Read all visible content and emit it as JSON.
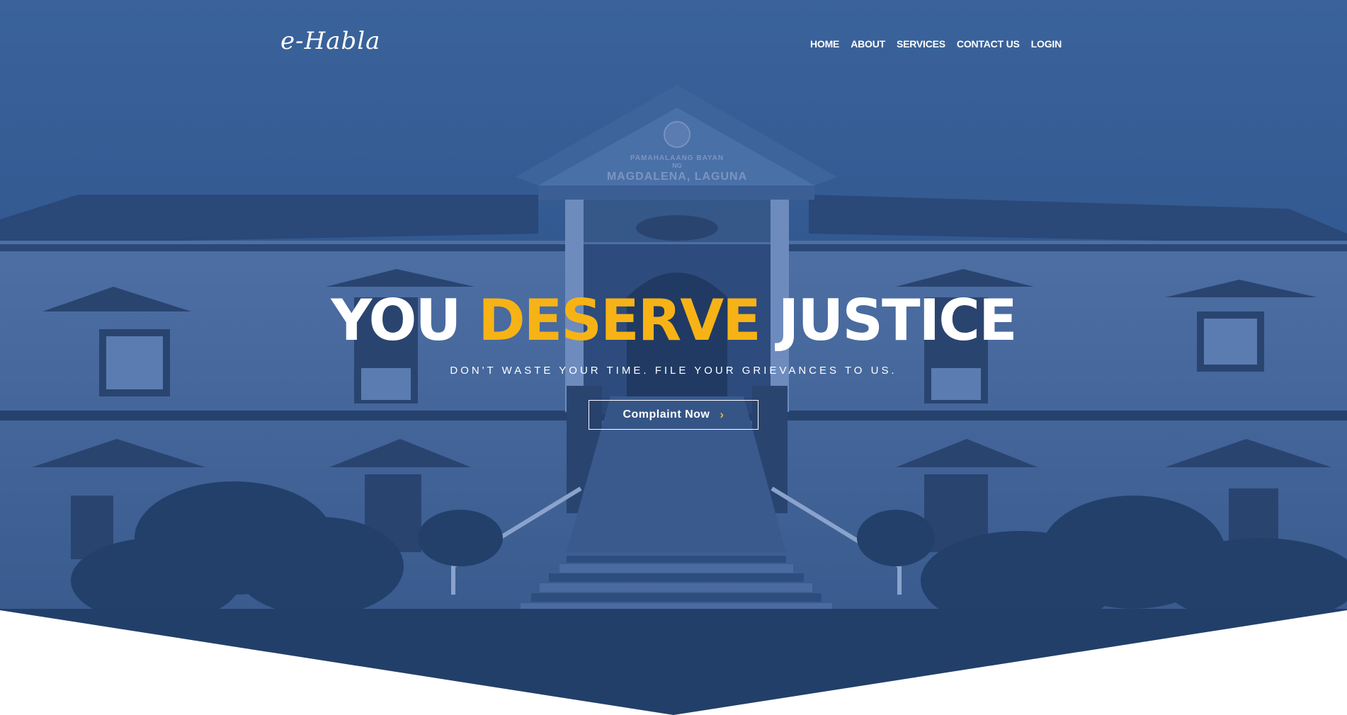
{
  "brand": {
    "logo_text": "e-Habla"
  },
  "nav": {
    "items": [
      "HOME",
      "ABOUT",
      "SERVICES",
      "CONTACT US",
      "LOGIN"
    ]
  },
  "hero": {
    "headline_part1": "YOU ",
    "headline_accent": "DESERVE",
    "headline_part2": " JUSTICE",
    "tagline": "DON'T WASTE YOUR TIME. FILE YOUR GRIEVANCES TO US.",
    "cta_label": "Complaint Now",
    "cta_icon": "chevron-right-icon",
    "building_sign_line1": "PAMAHALAANG BAYAN",
    "building_sign_line2": "NG",
    "building_sign_line3": "MAGDALENA, LAGUNA"
  },
  "colors": {
    "overlay": "#2b4f86",
    "accent": "#f7b316",
    "text": "#ffffff"
  }
}
